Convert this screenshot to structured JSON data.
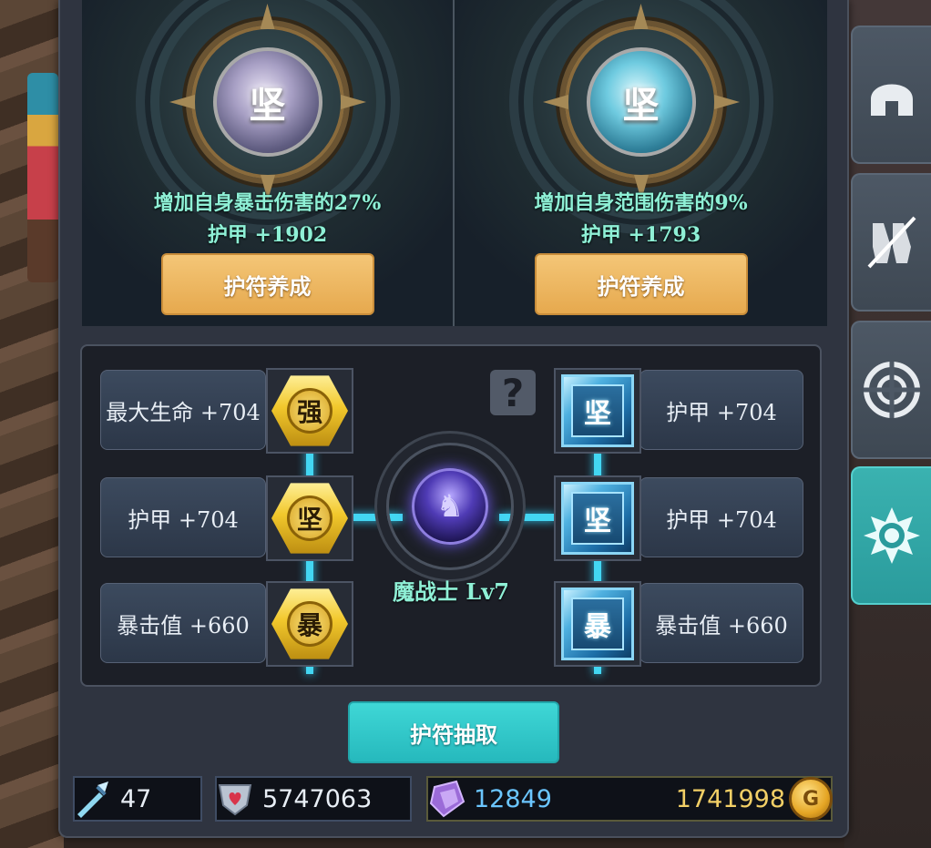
{
  "cards": [
    {
      "gem_glyph": "坚",
      "effect": "增加自身暴击伤害的27%",
      "armor": "护甲 +1902",
      "button": "护符养成"
    },
    {
      "gem_glyph": "坚",
      "effect": "增加自身范围伤害的9%",
      "armor": "护甲 +1793",
      "button": "护符养成"
    }
  ],
  "board": {
    "left_stats": [
      {
        "label": "最大生命 +704",
        "glyph": "强"
      },
      {
        "label": "护甲 +704",
        "glyph": "坚"
      },
      {
        "label": "暴击值 +660",
        "glyph": "暴"
      }
    ],
    "right_stats": [
      {
        "label": "护甲 +704",
        "glyph": "坚"
      },
      {
        "label": "护甲 +704",
        "glyph": "坚"
      },
      {
        "label": "暴击值 +660",
        "glyph": "暴"
      }
    ],
    "help_glyph": "?",
    "hero_name": "魔战士 Lv7"
  },
  "draw_button": "护符抽取",
  "resources": {
    "weapon_count": "47",
    "power": "5747063",
    "crystals": "12849",
    "gold": "1741998"
  },
  "coin_glyph": "G",
  "side_tabs": [
    {
      "icon": "helmet-icon",
      "active": false
    },
    {
      "icon": "gloves-icon",
      "active": false
    },
    {
      "icon": "shield-target-icon",
      "active": false
    },
    {
      "icon": "talisman-icon",
      "active": true
    }
  ],
  "colors": {
    "accent_teal": "#3ab2b0",
    "button_gold": "#e6a94e",
    "effect_text": "#8ff0d6",
    "link_cyan": "#43d6f2",
    "gold_text": "#f2cf66",
    "crystal_text": "#6bc6ff"
  }
}
